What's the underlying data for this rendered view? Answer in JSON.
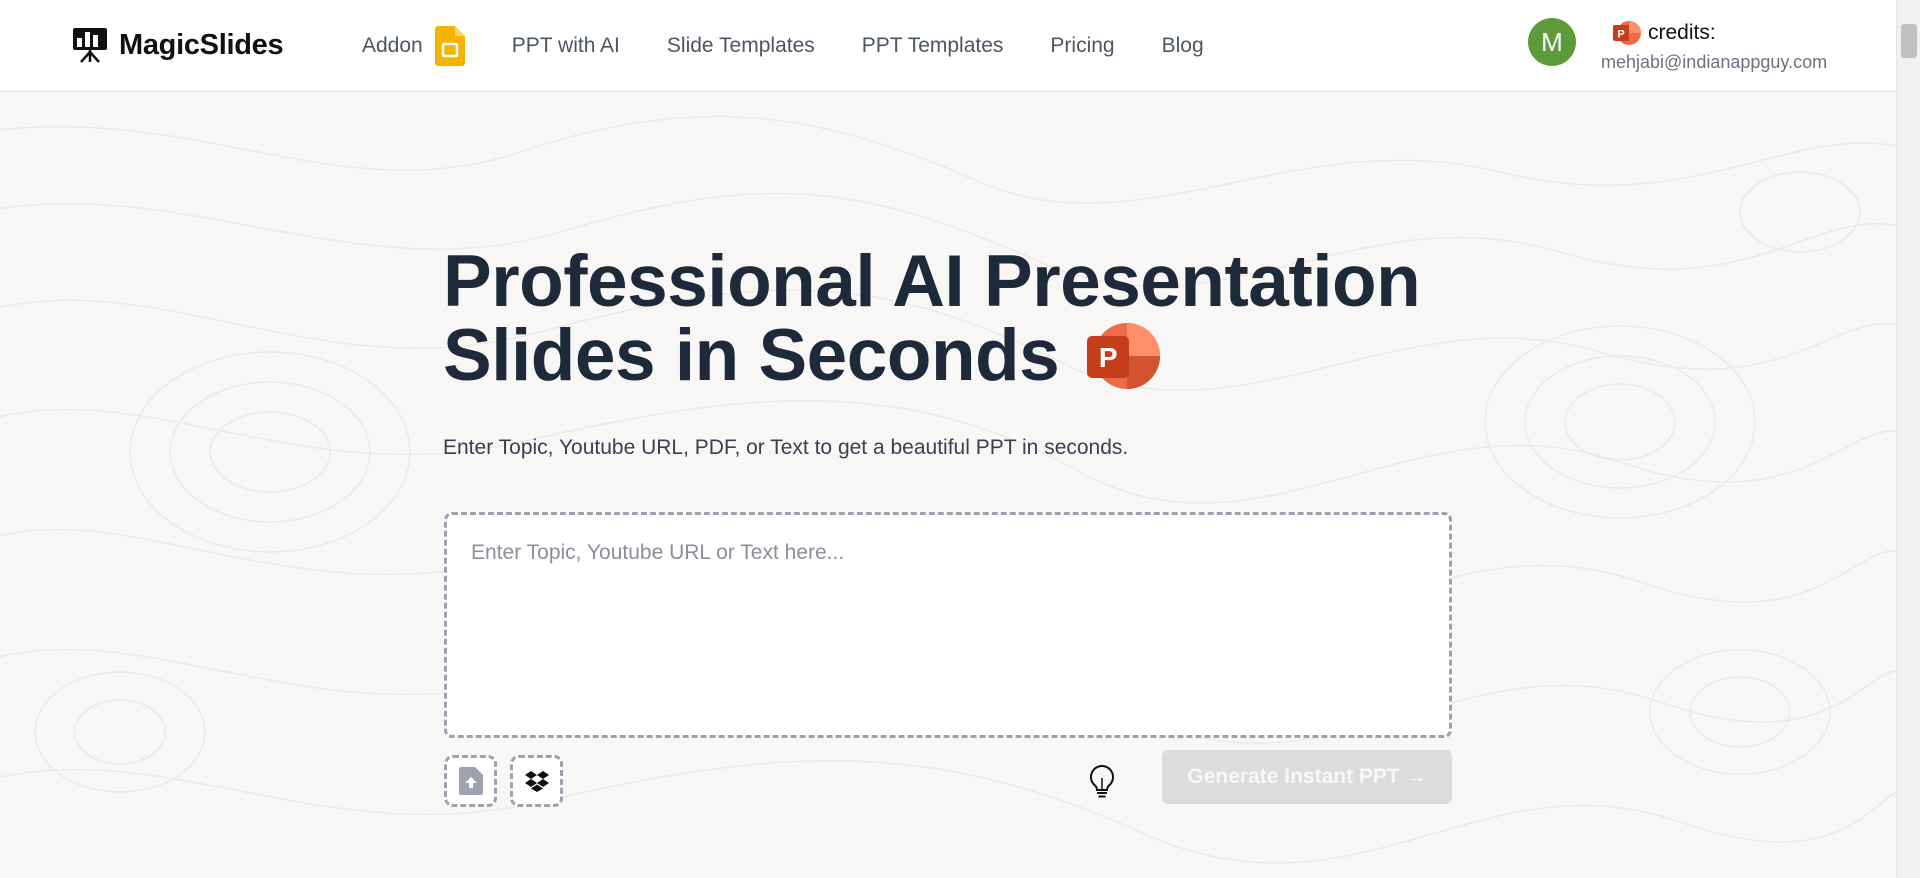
{
  "brand": {
    "name": "MagicSlides"
  },
  "nav": {
    "items": [
      {
        "label": "Addon",
        "icon": "google-slides-icon"
      },
      {
        "label": "PPT with AI"
      },
      {
        "label": "Slide Templates"
      },
      {
        "label": "PPT Templates"
      },
      {
        "label": "Pricing"
      },
      {
        "label": "Blog"
      }
    ]
  },
  "account": {
    "avatar_letter": "M",
    "avatar_color": "#5d9b3a",
    "credits_label": "credits:",
    "email": "mehjabi@indianappguy.com"
  },
  "hero": {
    "title_line1": "Professional AI Presentation",
    "title_line2": "Slides in Seconds",
    "subtitle": "Enter Topic, Youtube URL, PDF, or Text to get a beautiful PPT in seconds.",
    "input_placeholder": "Enter Topic, Youtube URL or Text here...",
    "input_value": "",
    "generate_label": "Generate Instant PPT →"
  },
  "icons": {
    "upload": "upload-file-icon",
    "dropbox": "dropbox-icon",
    "idea": "lightbulb-icon",
    "powerpoint": "powerpoint-icon"
  },
  "colors": {
    "powerpoint_orange": "#d24726",
    "google_slides_yellow": "#f4b400",
    "generate_disabled_bg": "#dcdcdc"
  }
}
